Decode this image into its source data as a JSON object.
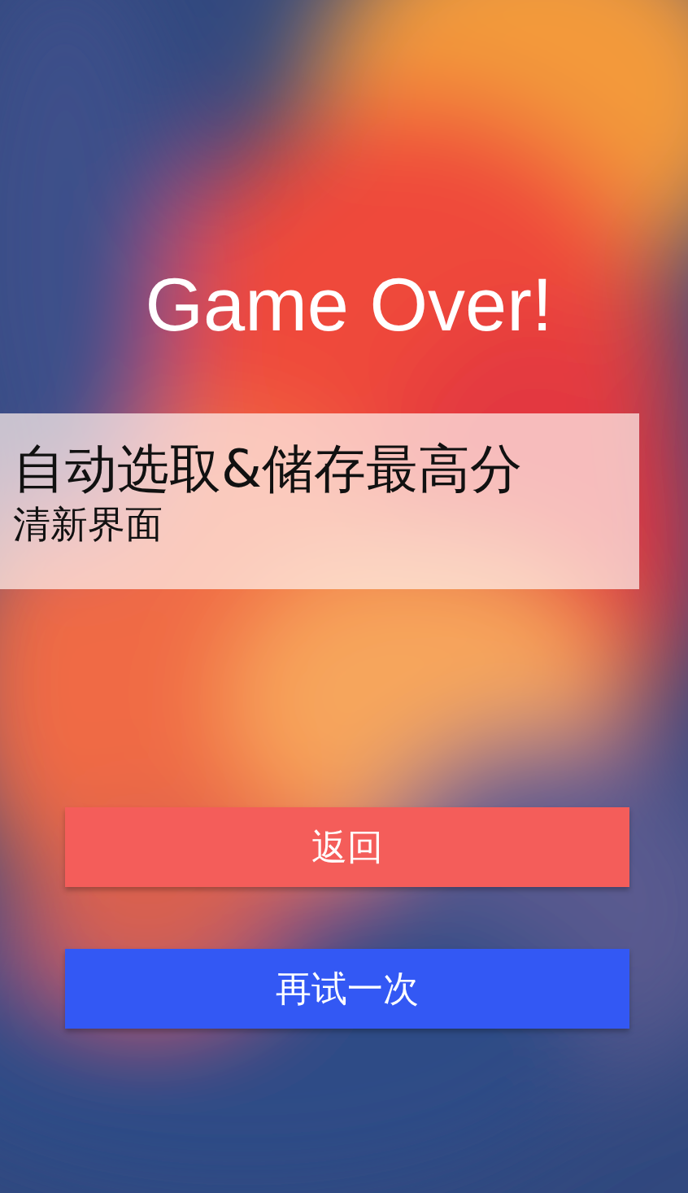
{
  "title": "Game Over!",
  "banner": {
    "heading": "自动选取&储存最高分",
    "subheading": "清新界面"
  },
  "buttons": [
    {
      "label": "返回",
      "kind": "back"
    },
    {
      "label": "再试一次",
      "kind": "retry"
    }
  ]
}
